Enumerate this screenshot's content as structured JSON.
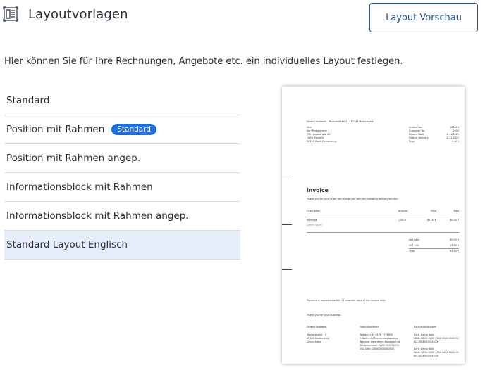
{
  "header": {
    "icon": "layout-template-icon",
    "title": "Layoutvorlagen",
    "preview_button": "Layout Vorschau"
  },
  "description": "Hier können Sie für Ihre Rechnungen, Angebote etc. ein individuelles Layout festlegen.",
  "templates": [
    {
      "label": "Standard"
    },
    {
      "label": "Position mit Rahmen",
      "badge": "Standard"
    },
    {
      "label": "Position mit Rahmen angep."
    },
    {
      "label": "Informationsblock mit Rahmen"
    },
    {
      "label": "Informationsblock mit Rahmen angep."
    },
    {
      "label": "Standard Layout Englisch",
      "selected": true
    }
  ],
  "preview": {
    "sender_line": "Demo Handwerk · Musterstraße 17 · 12345 Musterstadt",
    "recipient": [
      "Herr",
      "Karl Mustermann",
      "TMI Hauptstraße 40",
      "Cleta Mandela",
      "10114 Stadt Gemachung"
    ],
    "info_labels": [
      "Invoice No.",
      "Customer No.",
      "Invoice Date",
      "Date of Delivery",
      "Page"
    ],
    "info_values": [
      "100024",
      "1002",
      "18.11.2021",
      "18.11.2021",
      "1 of 1"
    ],
    "invoice_title": "Invoice",
    "intro": "Thank you for your order. We charge you with the following delivery/service:",
    "cols": [
      "Description",
      "Amount",
      "Price",
      "Total"
    ],
    "row": [
      "Montage",
      "1,00 h",
      "80,00 €",
      "80,00 €"
    ],
    "row_sub": "Lorem ipsum",
    "sum_labels": [
      "Net total",
      "VAT 19%",
      "Total"
    ],
    "sum_values": [
      "80,00 €",
      "15,20 €",
      "95,20 €"
    ],
    "payment": "Payment is requested within 14 calendar days of the invoice date.",
    "thanks": "Thank you for your business.",
    "footer": [
      [
        "Demo Handwerk",
        "Musterstraße 17",
        "12345 Musterstadt",
        "Deutschland"
      ],
      [
        "Geschäftsführer",
        "Telefon: +49 0176 7799000",
        "E-Mail: info@demo-handwerk.de",
        "Website: www.demo-handwerk.de",
        "Steuernummer: 0000 000 00000",
        "USt.-IdNr.: DE000000000000"
      ],
      [
        "Bankverbindungen",
        "Bank Demo Bank",
        "IBAN: DE00 0000 0000 0000 0000 00",
        "BIC: DEMODEXXXXX",
        "",
        "Bank Demo Bank",
        "IBAN: DE00 0000 0000 0000 0000 00",
        "BIC: DEMODEXXXXX"
      ]
    ]
  }
}
